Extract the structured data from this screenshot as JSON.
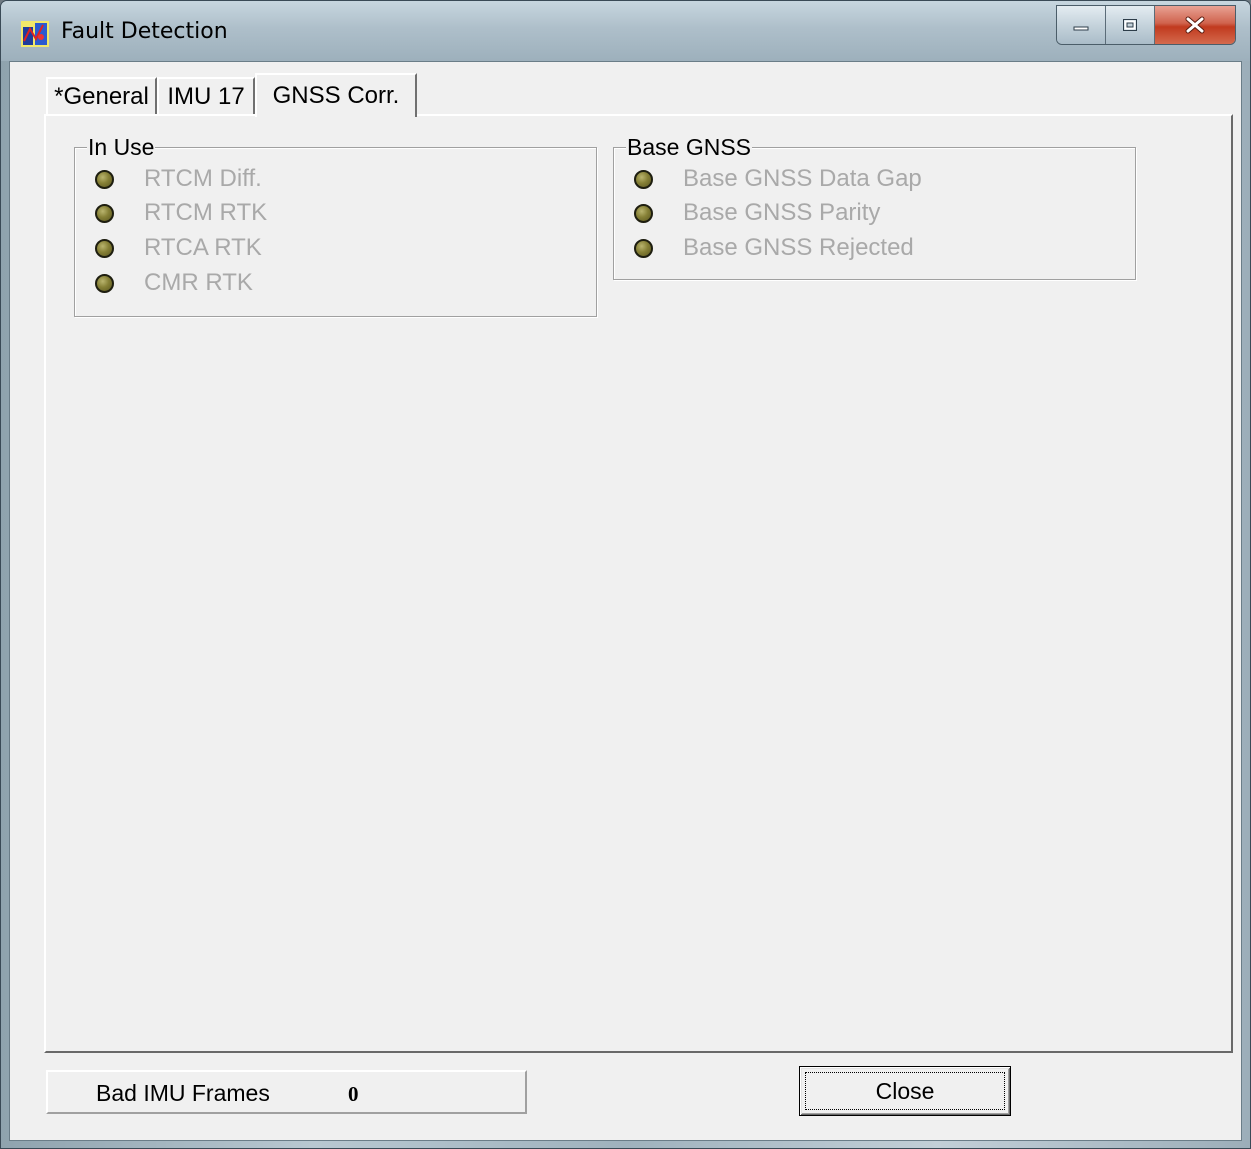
{
  "window": {
    "title": "Fault Detection",
    "icon": "application-icon",
    "controls": {
      "minimize_icon": "minimize-icon",
      "maximize_icon": "maximize-icon",
      "close_icon": "close-icon"
    }
  },
  "tabs": [
    {
      "label": "*General",
      "active": false
    },
    {
      "label": "IMU 17",
      "active": false
    },
    {
      "label": "GNSS Corr.",
      "active": true
    }
  ],
  "groups": {
    "in_use": {
      "title": "In Use",
      "items": [
        "RTCM Diff.",
        "RTCM RTK",
        "RTCA RTK",
        "CMR RTK"
      ]
    },
    "base_gnss": {
      "title": "Base GNSS",
      "items": [
        "Base GNSS Data Gap",
        "Base GNSS Parity",
        "Base GNSS Rejected"
      ]
    }
  },
  "status": {
    "label": "Bad IMU Frames",
    "value": "0"
  },
  "buttons": {
    "close_label": "Close"
  },
  "colors": {
    "indicator_off": "#868036",
    "disabled_text": "#a9a9a9",
    "dialog_face": "#f0f0f0"
  }
}
